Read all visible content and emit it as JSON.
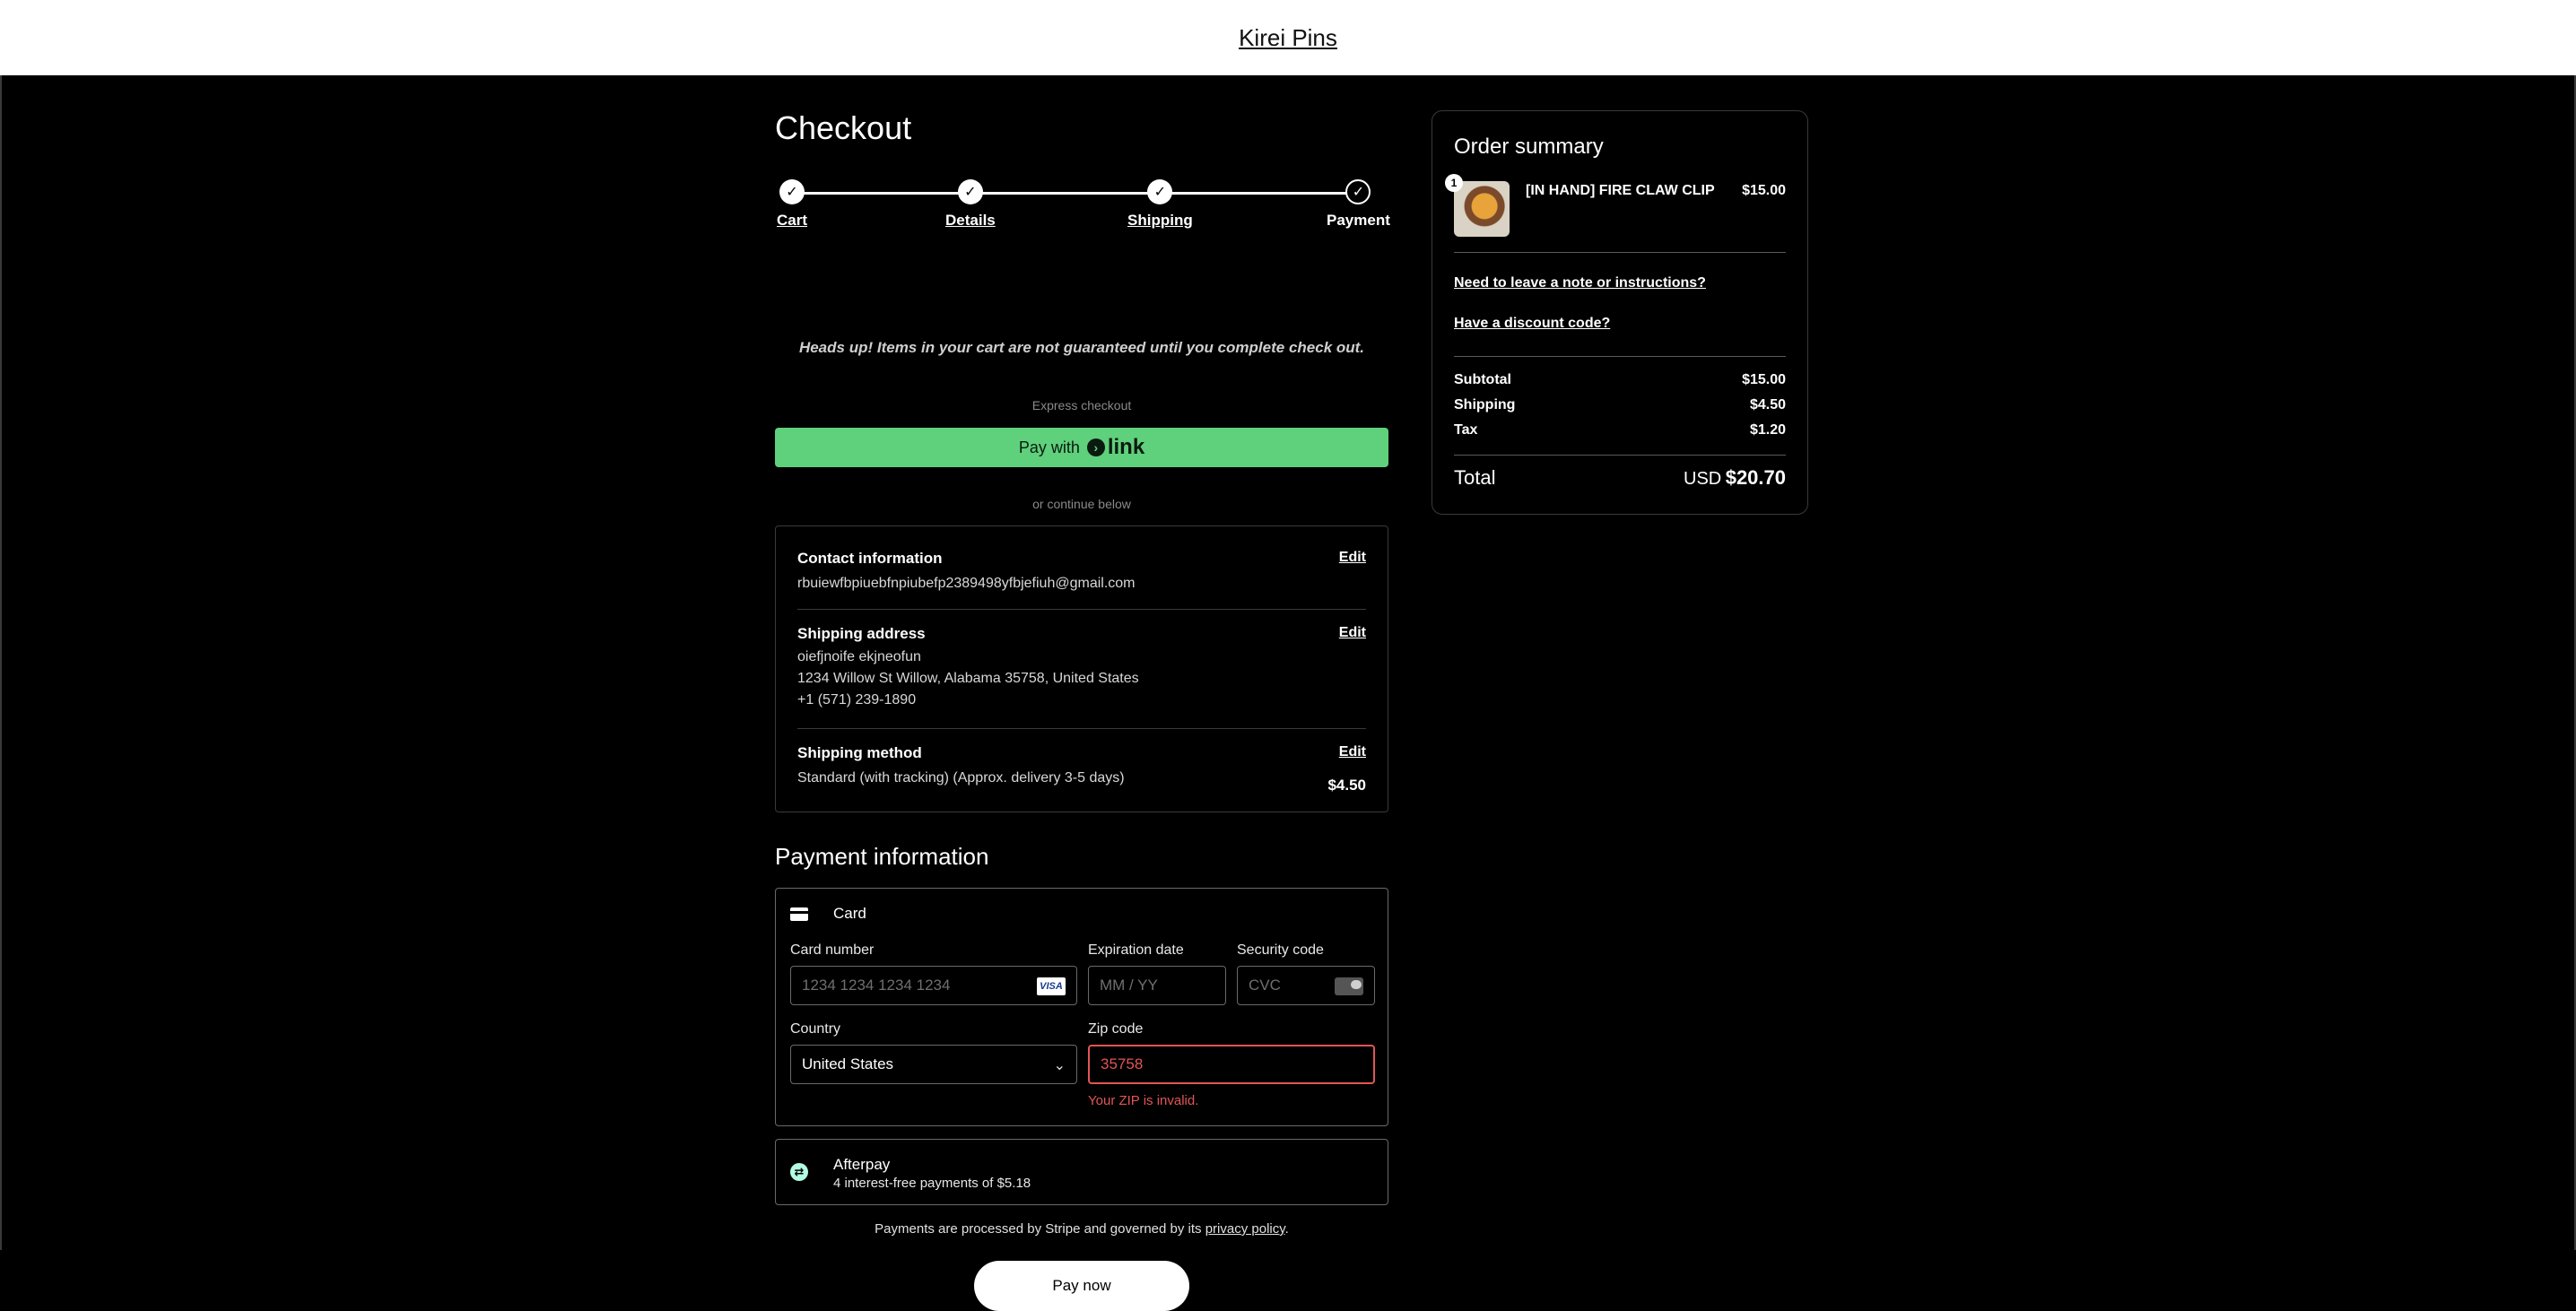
{
  "store": {
    "name": "Kirei Pins"
  },
  "checkout": {
    "title": "Checkout",
    "steps": [
      {
        "label": "Cart",
        "state": "done"
      },
      {
        "label": "Details",
        "state": "done"
      },
      {
        "label": "Shipping",
        "state": "done"
      },
      {
        "label": "Payment",
        "state": "current"
      }
    ],
    "headsup": "Heads up! Items in your cart are not guaranteed until you complete check out.",
    "express_label": "Express checkout",
    "link_button": {
      "prefix": "Pay with",
      "brand": "link"
    },
    "continue_label": "or continue below"
  },
  "summary": {
    "edit_label": "Edit",
    "contact": {
      "title": "Contact information",
      "email": "rbuiewfbpiuebfnpiubefp2389498yfbjefiuh@gmail.com"
    },
    "shipping_address": {
      "title": "Shipping address",
      "name": "oiefjnoife ekjneofun",
      "address": "1234 Willow St Willow, Alabama 35758, United States",
      "phone": "+1 (571) 239-1890"
    },
    "shipping_method": {
      "title": "Shipping method",
      "description": "Standard (with tracking) (Approx. delivery 3-5 days)",
      "price": "$4.50"
    }
  },
  "payment": {
    "title": "Payment information",
    "card": {
      "label": "Card",
      "card_number_label": "Card number",
      "card_number_placeholder": "1234 1234 1234 1234",
      "card_brand": "VISA",
      "expiry_label": "Expiration date",
      "expiry_placeholder": "MM / YY",
      "cvc_label": "Security code",
      "cvc_placeholder": "CVC",
      "country_label": "Country",
      "country_value": "United States",
      "zip_label": "Zip code",
      "zip_value": "35758",
      "zip_error": "Your ZIP is invalid."
    },
    "afterpay": {
      "title": "Afterpay",
      "subtitle": "4 interest-free payments of $5.18"
    },
    "stripe_note_prefix": "Payments are processed by Stripe and governed by its ",
    "stripe_note_link": "privacy policy",
    "stripe_note_suffix": ".",
    "pay_button": "Pay now"
  },
  "order": {
    "title": "Order summary",
    "item": {
      "quantity": "1",
      "name": "[IN HAND] FIRE CLAW CLIP",
      "price": "$15.00"
    },
    "note_link": "Need to leave a note or instructions?",
    "discount_link": "Have a discount code?",
    "subtotal_label": "Subtotal",
    "subtotal": "$15.00",
    "shipping_label": "Shipping",
    "shipping": "$4.50",
    "tax_label": "Tax",
    "tax": "$1.20",
    "total_label": "Total",
    "currency": "USD",
    "total": "$20.70"
  },
  "colors": {
    "link_green": "#5fd07b",
    "error_red": "#e25555",
    "background": "#000000"
  }
}
